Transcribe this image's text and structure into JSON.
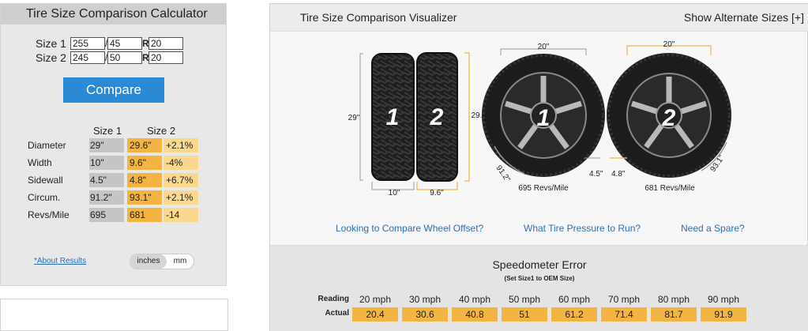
{
  "calculator": {
    "title": "Tire Size Comparison Calculator",
    "size1": {
      "label": "Size 1",
      "width": "255",
      "ratio": "45",
      "rim_mark": "R",
      "rim": "20"
    },
    "size2": {
      "label": "Size 2",
      "width": "245",
      "ratio": "50",
      "rim_mark": "R",
      "rim": "20"
    },
    "separator": "/",
    "compare_label": "Compare",
    "col_size1": "Size 1",
    "col_size2": "Size 2",
    "rows": [
      {
        "name": "Diameter",
        "s1": "29\"",
        "s2": "29.6\"",
        "diff": "+2.1%"
      },
      {
        "name": "Width",
        "s1": "10\"",
        "s2": "9.6\"",
        "diff": "-4%"
      },
      {
        "name": "Sidewall",
        "s1": "4.5\"",
        "s2": "4.8\"",
        "diff": "+6.7%"
      },
      {
        "name": "Circum.",
        "s1": "91.2\"",
        "s2": "93.1\"",
        "diff": "+2.1%"
      },
      {
        "name": "Revs/Mile",
        "s1": "695",
        "s2": "681",
        "diff": "-14"
      }
    ],
    "about_link": "*About Results",
    "unit_inches": "inches",
    "unit_mm": "mm"
  },
  "visualizer": {
    "title": "Tire Size Comparison Visualizer",
    "alt_sizes": "Show Alternate Sizes [+]",
    "tire1_num": "1",
    "tire2_num": "2",
    "h1": "29\"",
    "h2": "29.6\"",
    "w1": "10\"",
    "w2": "9.6\"",
    "rim1": "20\"",
    "rim2": "20\"",
    "circ1": "91.2\"",
    "circ2": "93.1\"",
    "side1": "4.5\"",
    "side2": "4.8\"",
    "revs1": "695 Revs/Mile",
    "revs2": "681 Revs/Mile",
    "link_offset": "Looking to Compare Wheel Offset?",
    "link_pressure": "What Tire Pressure to Run?",
    "link_spare": "Need a Spare?"
  },
  "speedometer": {
    "title": "Speedometer Error",
    "subtitle": "(Set Size1 to OEM Size)",
    "reading_label": "Reading",
    "actual_label": "Actual",
    "readings": [
      "20 mph",
      "30 mph",
      "40 mph",
      "50 mph",
      "60 mph",
      "70 mph",
      "80 mph",
      "90 mph"
    ],
    "actuals": [
      "20.4",
      "30.6",
      "40.8",
      "51",
      "61.2",
      "71.4",
      "81.7",
      "91.9"
    ]
  },
  "colors": {
    "accent": "#2b8ad6",
    "size2_fill": "#f2b543",
    "diff_fill": "#fad88e",
    "size1_fill": "#c5c5c5",
    "dim_line": "#f2b543"
  }
}
